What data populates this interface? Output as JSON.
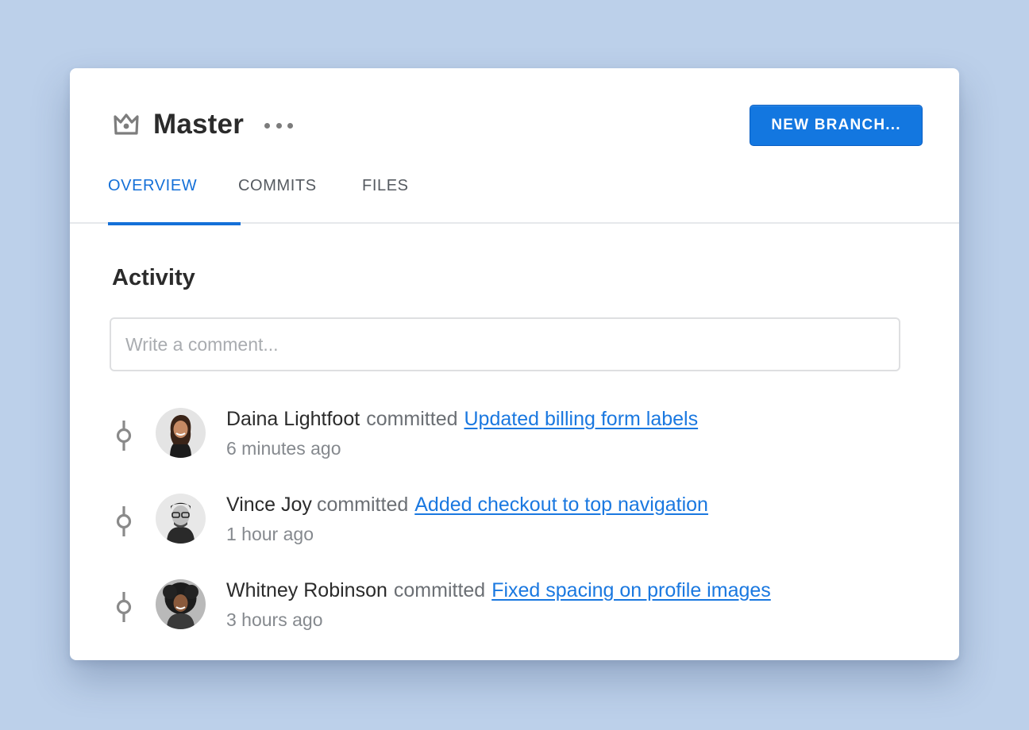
{
  "header": {
    "title": "Master",
    "icon": "crown-icon",
    "more_icon": "more-dots-icon",
    "new_branch_label": "NEW BRANCH..."
  },
  "tabs": [
    {
      "label": "OVERVIEW",
      "active": true
    },
    {
      "label": "COMMITS",
      "active": false
    },
    {
      "label": "FILES",
      "active": false
    }
  ],
  "activity": {
    "heading": "Activity",
    "comment_placeholder": "Write a comment...",
    "comment_value": "",
    "items": [
      {
        "author": "Daina Lightfoot",
        "verb": "committed",
        "message": "Updated billing form labels",
        "time": "6 minutes ago"
      },
      {
        "author": "Vince Joy",
        "verb": "committed",
        "message": "Added checkout to top navigation",
        "time": "1 hour ago"
      },
      {
        "author": "Whitney Robinson",
        "verb": "committed",
        "message": "Fixed spacing on profile images",
        "time": "3 hours ago"
      }
    ]
  },
  "colors": {
    "accent": "#1470d8",
    "button": "#1377e0",
    "link": "#1a78e0",
    "background": "#bcd0ea"
  }
}
